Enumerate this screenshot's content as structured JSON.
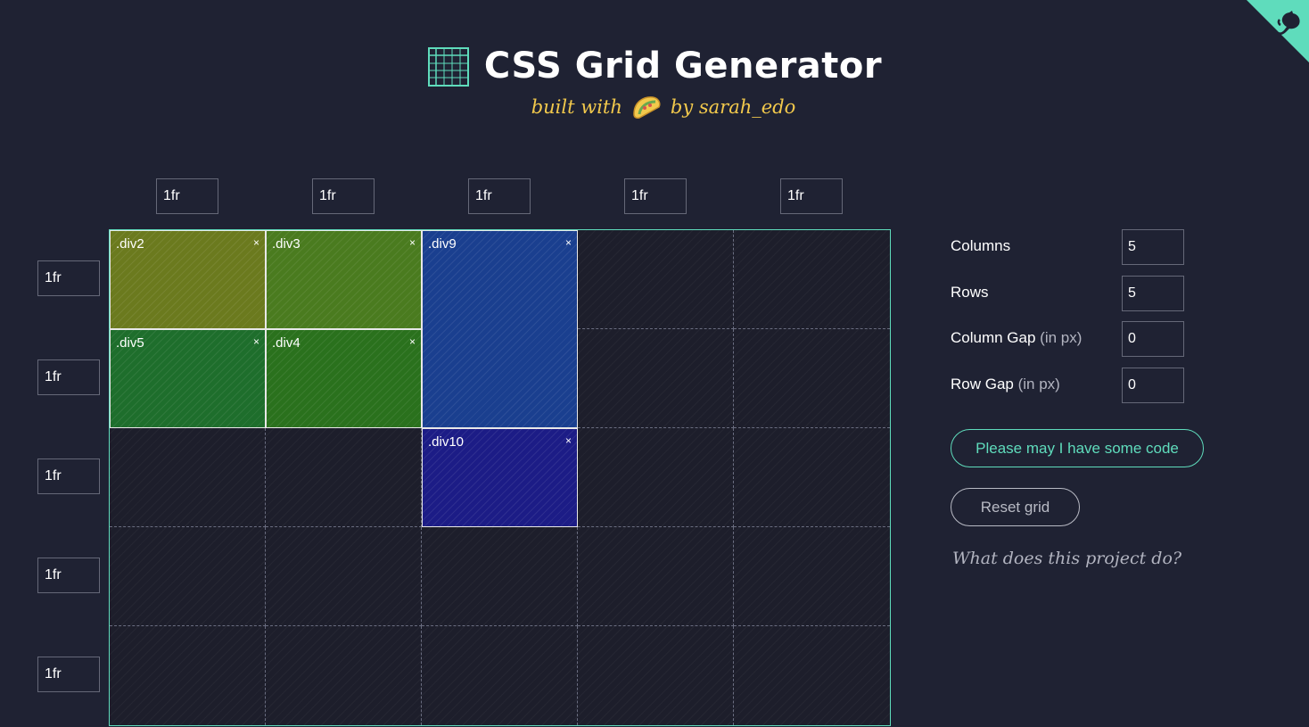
{
  "header": {
    "title": "CSS Grid Generator",
    "subtitle_prefix": "built with",
    "subtitle_suffix": "by sarah_edo",
    "logo_icon": "grid-icon",
    "taco_icon": "taco-icon"
  },
  "corner_icon": "github-octocat-icon",
  "columns_tracks": [
    "1fr",
    "1fr",
    "1fr",
    "1fr",
    "1fr"
  ],
  "rows_tracks": [
    "1fr",
    "1fr",
    "1fr",
    "1fr",
    "1fr"
  ],
  "grid_items": [
    {
      "label": ".div2",
      "col_start": 1,
      "col_span": 1,
      "row_start": 1,
      "row_span": 1,
      "color": "#6b7a1e"
    },
    {
      "label": ".div3",
      "col_start": 2,
      "col_span": 1,
      "row_start": 1,
      "row_span": 1,
      "color": "#4a7b1f"
    },
    {
      "label": ".div9",
      "col_start": 3,
      "col_span": 1,
      "row_start": 1,
      "row_span": 2,
      "color": "#1a3f8f"
    },
    {
      "label": ".div5",
      "col_start": 1,
      "col_span": 1,
      "row_start": 2,
      "row_span": 1,
      "color": "#1e6e2c"
    },
    {
      "label": ".div4",
      "col_start": 2,
      "col_span": 1,
      "row_start": 2,
      "row_span": 1,
      "color": "#2a711d"
    },
    {
      "label": ".div10",
      "col_start": 3,
      "col_span": 1,
      "row_start": 3,
      "row_span": 1,
      "color": "#1c1c86"
    }
  ],
  "close_symbol": "×",
  "controls": {
    "columns_label": "Columns",
    "columns_value": "5",
    "rows_label": "Rows",
    "rows_value": "5",
    "column_gap_label": "Column Gap",
    "column_gap_hint": "(in px)",
    "column_gap_value": "0",
    "row_gap_label": "Row Gap",
    "row_gap_hint": "(in px)",
    "row_gap_value": "0",
    "code_button": "Please may I have some code",
    "reset_button": "Reset grid",
    "about_link": "What does this project do?"
  },
  "colors": {
    "background": "#1f2233",
    "accent": "#5fdcbc",
    "subtitle": "#f2c94c"
  }
}
